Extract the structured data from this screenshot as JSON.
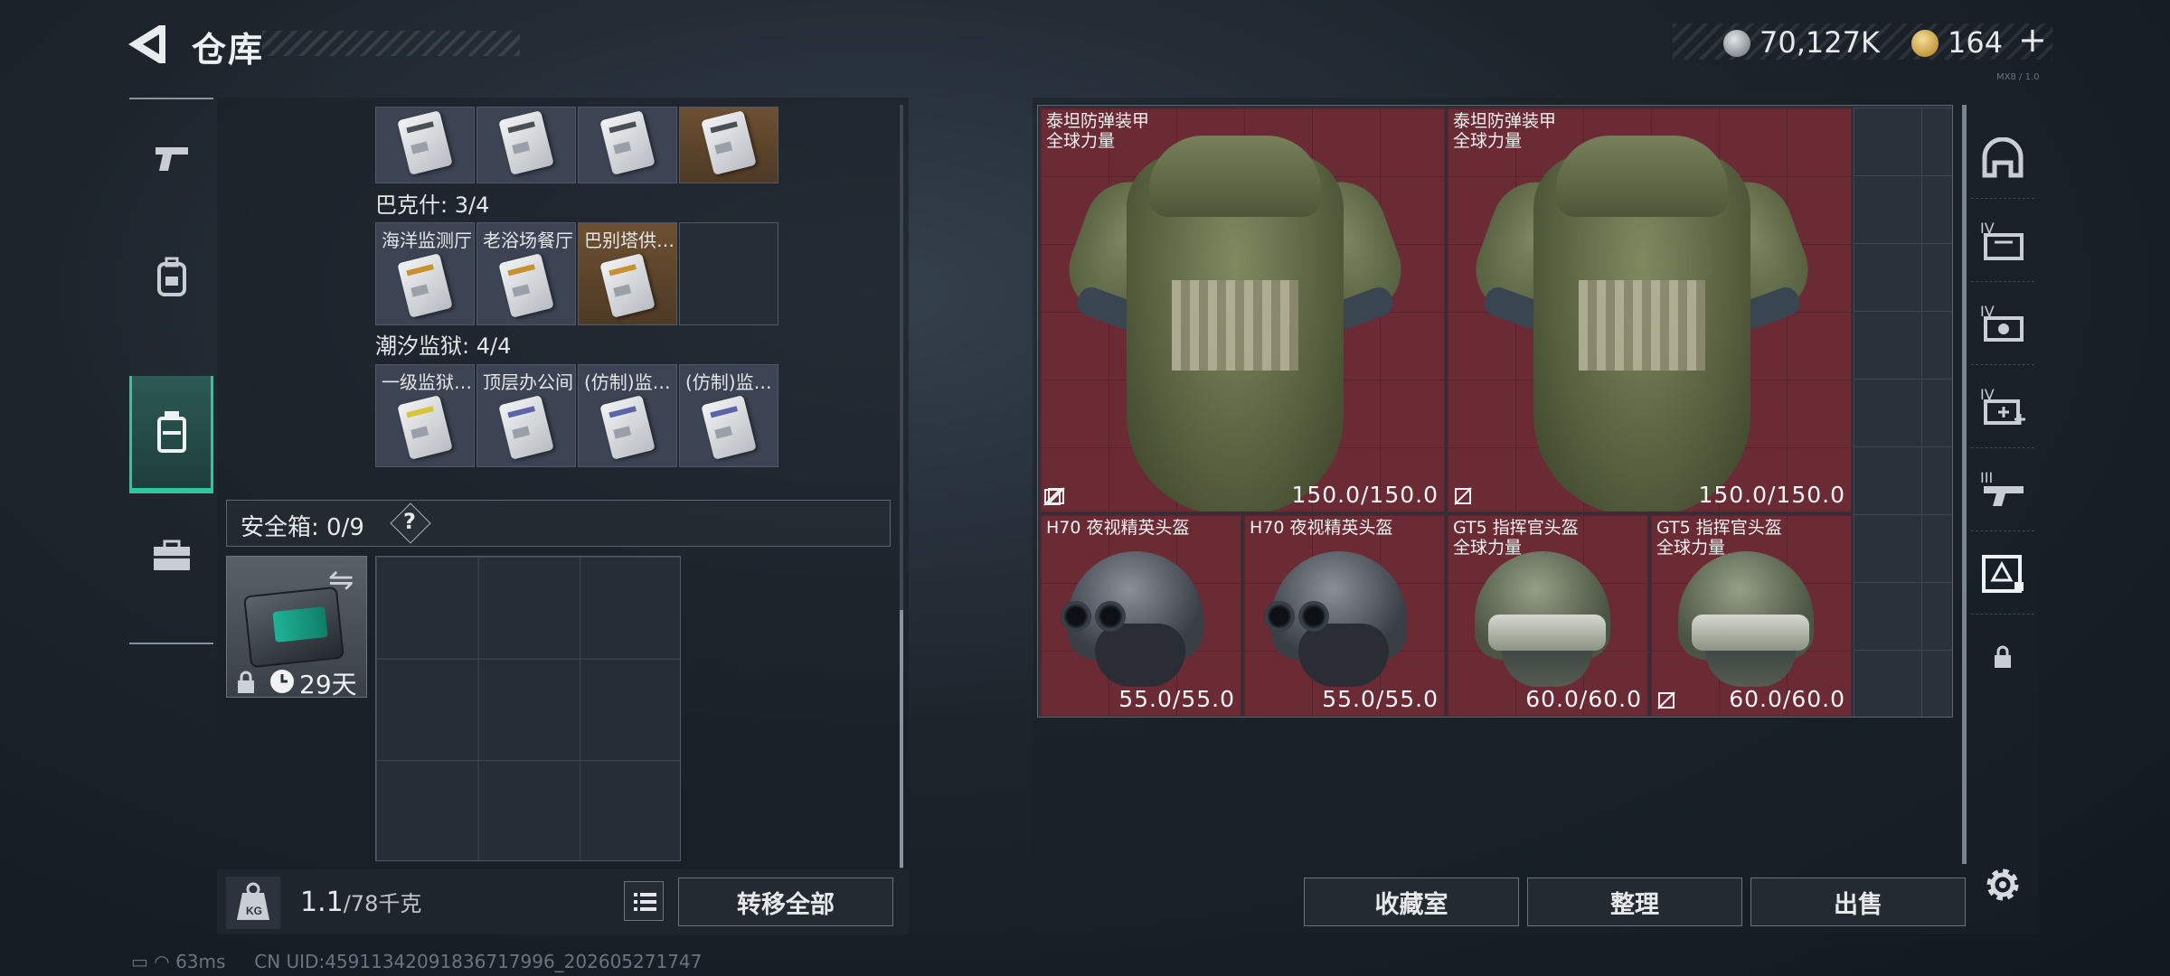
{
  "header": {
    "title": "仓库",
    "currency_silver": "70,127K",
    "currency_gold": "164",
    "currency_plus": "+",
    "version_mark": "MX8 / 1.0"
  },
  "left_nav": {
    "tabs": [
      {
        "name": "weapons",
        "icon": "pistol-icon",
        "active": false
      },
      {
        "name": "gear",
        "icon": "backpack-icon",
        "active": false
      },
      {
        "name": "storage",
        "icon": "container-icon",
        "active": true
      },
      {
        "name": "briefcase",
        "icon": "briefcase-icon",
        "active": false
      }
    ]
  },
  "storage": {
    "group_top": {
      "items": [
        "",
        "",
        "",
        ""
      ]
    },
    "group_baxis": {
      "title": "巴克什: 3/4",
      "items": [
        "海洋监测厅",
        "老浴场餐厅",
        "巴别塔供…",
        ""
      ]
    },
    "group_tide": {
      "title": "潮汐监狱: 4/4",
      "items": [
        "一级监狱…",
        "顶层办公间",
        "(仿制)监…",
        "(仿制)监…"
      ]
    },
    "safe_box": {
      "label": "安全箱: 0/9",
      "help": "?",
      "days": "29天"
    },
    "weight": {
      "current": "1.1",
      "max": "/78千克"
    },
    "transfer_all": "转移全部"
  },
  "equipment": {
    "armors": [
      {
        "name": "泰坦防弹装甲",
        "tag": "全球力量",
        "durability": "150.0/150.0"
      },
      {
        "name": "泰坦防弹装甲",
        "tag": "全球力量",
        "durability": "150.0/150.0"
      }
    ],
    "helmets": [
      {
        "name": "H70 夜视精英头盔",
        "tag": "",
        "durability": "55.0/55.0",
        "style": "nv"
      },
      {
        "name": "H70 夜视精英头盔",
        "tag": "",
        "durability": "55.0/55.0",
        "style": "nv"
      },
      {
        "name": "GT5 指挥官头盔",
        "tag": "全球力量",
        "durability": "60.0/60.0",
        "style": "gt5"
      },
      {
        "name": "GT5 指挥官头盔",
        "tag": "全球力量",
        "durability": "60.0/60.0",
        "style": "gt5"
      }
    ],
    "colors": {
      "item_bg": "#6b2b34",
      "accent": "#30c79a"
    }
  },
  "right_nav": {
    "items": [
      {
        "icon": "helmet-slot-icon",
        "label": ""
      },
      {
        "icon": "armor-tier-icon",
        "label": "IV"
      },
      {
        "icon": "weapon-tier-icon",
        "label": "IV"
      },
      {
        "icon": "medkit-tier-icon",
        "label": "IV"
      },
      {
        "icon": "gun-tier-icon",
        "label": "III"
      },
      {
        "icon": "filter-icon",
        "label": ""
      },
      {
        "icon": "lock-icon",
        "label": ""
      }
    ]
  },
  "buttons": {
    "collection": "收藏室",
    "organize": "整理",
    "sell": "出售"
  },
  "status": {
    "ping": "63ms",
    "uid": "CN UID:4591134209183671799​6_202605271747"
  }
}
